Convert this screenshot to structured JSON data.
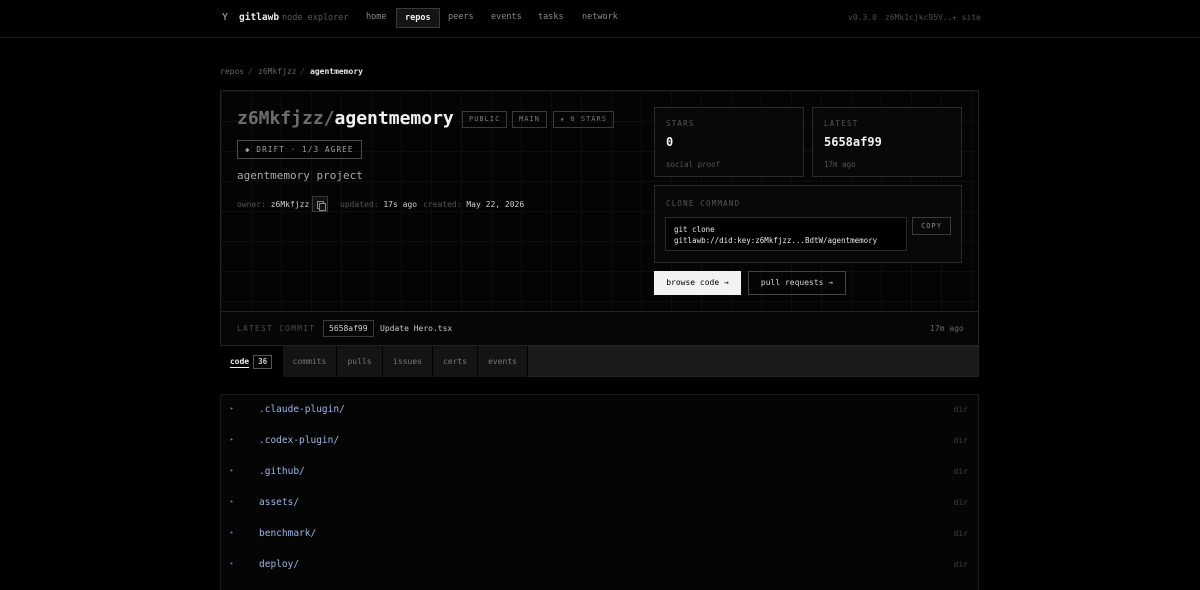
{
  "app": {
    "logo_glyph": "Y",
    "name": "gitlawb",
    "subtitle": "node explorer"
  },
  "nav": {
    "items": [
      {
        "label": "home",
        "active": false
      },
      {
        "label": "repos",
        "active": true
      },
      {
        "label": "peers",
        "active": false
      },
      {
        "label": "events",
        "active": false
      },
      {
        "label": "tasks",
        "active": false
      },
      {
        "label": "network",
        "active": false
      }
    ],
    "version": "v0.3.0",
    "node_id": "z6Mk1cjkc95V...",
    "site_link": "+ site"
  },
  "breadcrumb": {
    "items": [
      "repos",
      "z6Mkfjzz",
      "agentmemory"
    ],
    "separator": "/"
  },
  "repo": {
    "owner": "z6Mkfjzz/",
    "name": "agentmemory",
    "badges": [
      "PUBLIC",
      "MAIN",
      "★ 0 STARS"
    ],
    "drift": "◆ DRIFT · 1/3 AGREE",
    "description": "agentmemory project",
    "owner_label": "owner:",
    "owner_value": "z6Mkfjzz",
    "updated_label": "updated:",
    "updated_value": "17s ago",
    "created_label": "created:",
    "created_value": "May 22, 2026"
  },
  "stats": [
    {
      "label": "STARS",
      "value": "0",
      "sub": "social proof"
    },
    {
      "label": "LATEST",
      "value": "5658af99",
      "sub": "17m ago"
    }
  ],
  "clone": {
    "label": "CLONE COMMAND",
    "line1": "git clone",
    "line2": "gitlawb://did:key:z6Mkfjzz...BdtW/agentmemory",
    "copy_label": "COPY"
  },
  "actions": {
    "browse": "browse code →",
    "pulls": "pull requests →"
  },
  "latest_commit": {
    "label": "LATEST COMMIT",
    "hash": "5658af99",
    "message": "Update Hero.tsx",
    "time": "17m ago"
  },
  "tabs": [
    {
      "label": "code",
      "count": "36",
      "active": true
    },
    {
      "label": "commits",
      "active": false
    },
    {
      "label": "pulls",
      "active": false
    },
    {
      "label": "issues",
      "active": false
    },
    {
      "label": "certs",
      "active": false
    },
    {
      "label": "events",
      "active": false
    }
  ],
  "files": [
    {
      "name": ".claude-plugin/",
      "type": "dir"
    },
    {
      "name": ".codex-plugin/",
      "type": "dir"
    },
    {
      "name": ".github/",
      "type": "dir"
    },
    {
      "name": "assets/",
      "type": "dir"
    },
    {
      "name": "benchmark/",
      "type": "dir"
    },
    {
      "name": "deploy/",
      "type": "dir"
    }
  ],
  "colors": {
    "background": "#000000",
    "accent_link": "#9ab6e6",
    "primary_button": "#f2f2f2"
  }
}
